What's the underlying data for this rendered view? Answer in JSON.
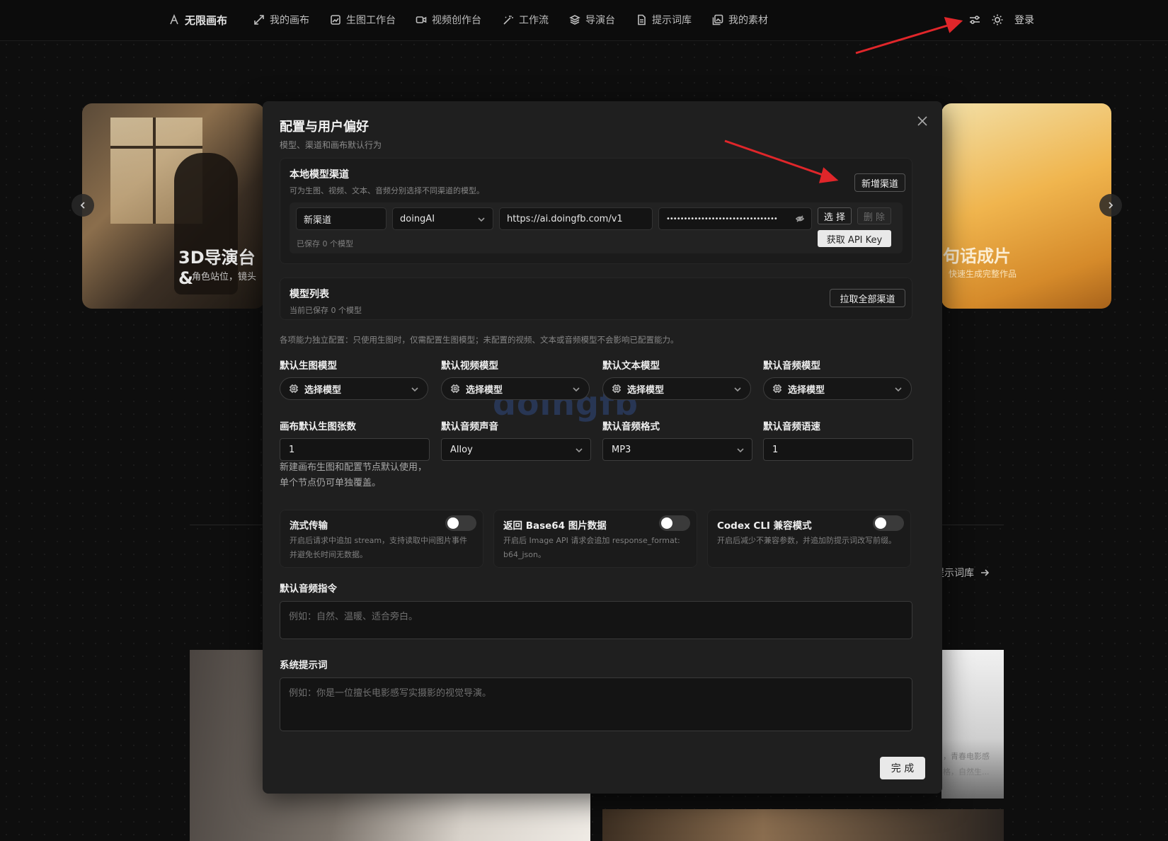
{
  "nav": {
    "brand": "无限画布",
    "items": [
      "我的画布",
      "生图工作台",
      "视频创作台",
      "工作流",
      "导演台",
      "提示词库",
      "我的素材"
    ],
    "login": "登录"
  },
  "background": {
    "hero_left_title": "3D导演台&",
    "hero_left_sub": "角色站位，镜头",
    "hero_right_title": "句话成片",
    "hero_right_sub": "快速生成完整作品",
    "link_text": "提示词库",
    "gallery_text_1": "，青春电影感",
    "gallery_text_2": "格，自然生..."
  },
  "modal": {
    "title": "配置与用户偏好",
    "subtitle": "模型、渠道和画布默认行为",
    "local_channel": {
      "title": "本地模型渠道",
      "subtitle": "可为生图、视频、文本、音频分别选择不同渠道的模型。",
      "add_button": "新增渠道",
      "channel_name": "新渠道",
      "provider": "doingAI",
      "base_url": "https://ai.doingfb.com/v1",
      "api_key_masked": "••••••••••••••••••••••••••••••••",
      "select_button": "选 择",
      "delete_button": "删 除",
      "get_key_button": "获取 API Key",
      "saved_count": "已保存 0 个模型"
    },
    "model_list": {
      "title": "模型列表",
      "subtitle": "当前已保存 0 个模型",
      "pull_button": "拉取全部渠道"
    },
    "note": "各项能力独立配置：只使用生图时，仅需配置生图模型；未配置的视频、文本或音频模型不会影响已配置能力。",
    "defaults": {
      "image_model_label": "默认生图模型",
      "video_model_label": "默认视频模型",
      "text_model_label": "默认文本模型",
      "audio_model_label": "默认音频模型",
      "select_placeholder": "选择模型",
      "image_count_label": "画布默认生图张数",
      "image_count_value": "1",
      "voice_label": "默认音频声音",
      "voice_value": "Alloy",
      "format_label": "默认音频格式",
      "format_value": "MP3",
      "speed_label": "默认音频语速",
      "speed_value": "1",
      "help": "新建画布生图和配置节点默认使用，单个节点仍可单独覆盖。"
    },
    "watermark": "doingfb",
    "toggles": [
      {
        "title": "流式传输",
        "desc": "开启后请求中追加 stream，支持读取中间图片事件并避免长时间无数据。",
        "on": false
      },
      {
        "title": "返回 Base64 图片数据",
        "desc": "开启后 Image API 请求会追加 response_format: b64_json。",
        "on": false
      },
      {
        "title": "Codex CLI 兼容模式",
        "desc": "开启后减少不兼容参数，并追加防提示词改写前缀。",
        "on": false
      }
    ],
    "audio_instruction_label": "默认音频指令",
    "audio_instruction_placeholder": "例如：自然、温暖、适合旁白。",
    "system_prompt_label": "系统提示词",
    "system_prompt_placeholder": "例如：你是一位擅长电影感写实摄影的视觉导演。",
    "done_button": "完 成"
  },
  "colors": {
    "annotation_arrow": "#e0262a",
    "modal_bg": "#1f1f1f",
    "page_bg": "#0e0e0e"
  }
}
